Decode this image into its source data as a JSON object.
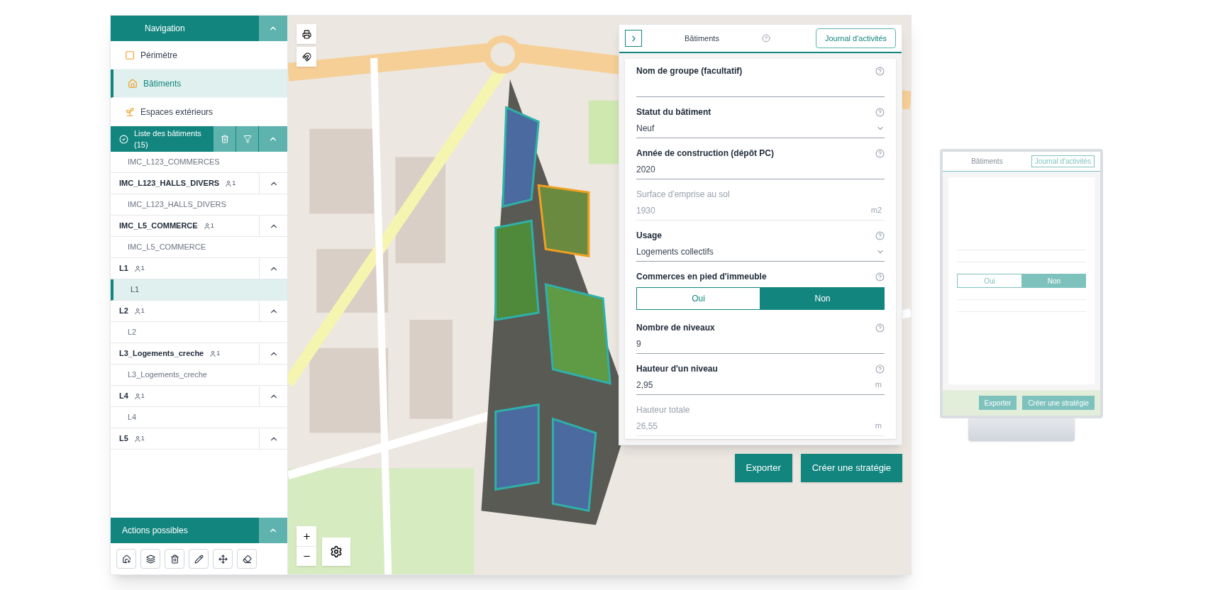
{
  "sidebar": {
    "title": "Navigation",
    "nav_items": [
      {
        "label": "Périmètre",
        "selected": false
      },
      {
        "label": "Bâtiments",
        "selected": true
      },
      {
        "label": "Espaces extérieurs",
        "selected": false
      }
    ],
    "list_title": "Liste des bâtiments (15)",
    "buildings": [
      {
        "kind": "item",
        "name": "IMC_L123_COMMERCES",
        "selected": false
      },
      {
        "kind": "group",
        "name": "IMC_L123_HALLS_DIVERS",
        "count": "1",
        "expanded": true,
        "children": [
          {
            "name": "IMC_L123_HALLS_DIVERS",
            "selected": false
          }
        ]
      },
      {
        "kind": "group",
        "name": "IMC_L5_COMMERCE",
        "count": "1",
        "expanded": true,
        "children": [
          {
            "name": "IMC_L5_COMMERCE",
            "selected": false
          }
        ]
      },
      {
        "kind": "group",
        "name": "L1",
        "count": "1",
        "expanded": true,
        "children": [
          {
            "name": "L1",
            "selected": true
          }
        ]
      },
      {
        "kind": "group",
        "name": "L2",
        "count": "1",
        "expanded": true,
        "children": [
          {
            "name": "L2",
            "selected": false
          }
        ]
      },
      {
        "kind": "group",
        "name": "L3_Logements_creche",
        "count": "1",
        "expanded": true,
        "children": [
          {
            "name": "L3_Logements_creche",
            "selected": false
          }
        ]
      },
      {
        "kind": "group",
        "name": "L4",
        "count": "1",
        "expanded": true,
        "children": [
          {
            "name": "L4",
            "selected": false
          }
        ]
      },
      {
        "kind": "group",
        "name": "L5",
        "count": "1",
        "expanded": true
      }
    ],
    "actions_title": "Actions possibles"
  },
  "panel": {
    "title": "Bâtiments",
    "log_button": "Journal d'activités",
    "fields": [
      {
        "kind": "text",
        "label": "Nom de groupe (facultatif)",
        "disabled": false
      },
      {
        "kind": "select",
        "label": "Statut du bâtiment",
        "value": "Neuf",
        "disabled": false
      },
      {
        "kind": "text",
        "label": "Année de construction (dépôt PC)",
        "value": "2020",
        "disabled": false
      },
      {
        "kind": "text",
        "label": "Surface d'emprise au sol",
        "value": "1930",
        "unit": "m2",
        "disabled": true
      },
      {
        "kind": "select",
        "label": "Usage",
        "value": "Logements collectifs",
        "disabled": false
      },
      {
        "kind": "toggle",
        "label": "Commerces en pied d'immeuble",
        "options": [
          {
            "label": "Oui",
            "selected": false
          },
          {
            "label": "Non",
            "selected": true
          }
        ],
        "disabled": false
      },
      {
        "kind": "text",
        "label": "Nombre de niveaux",
        "value": "9",
        "disabled": false
      },
      {
        "kind": "text",
        "label": "Hauteur d'un niveau",
        "value": "2,95",
        "unit": "m",
        "disabled": false
      },
      {
        "kind": "text",
        "label": "Hauteur totale",
        "value": "26,55",
        "unit": "m",
        "disabled": true
      }
    ]
  },
  "buttons": [
    "Exporter",
    "Créer une stratégie"
  ],
  "monitor": {
    "title": "Bâtiments",
    "log_button": "Journal d'activités",
    "options": [
      {
        "label": "Oui",
        "selected": false
      },
      {
        "label": "Non",
        "selected": true
      }
    ],
    "buttons": [
      "Exporter",
      "Créer une stratégie"
    ]
  }
}
